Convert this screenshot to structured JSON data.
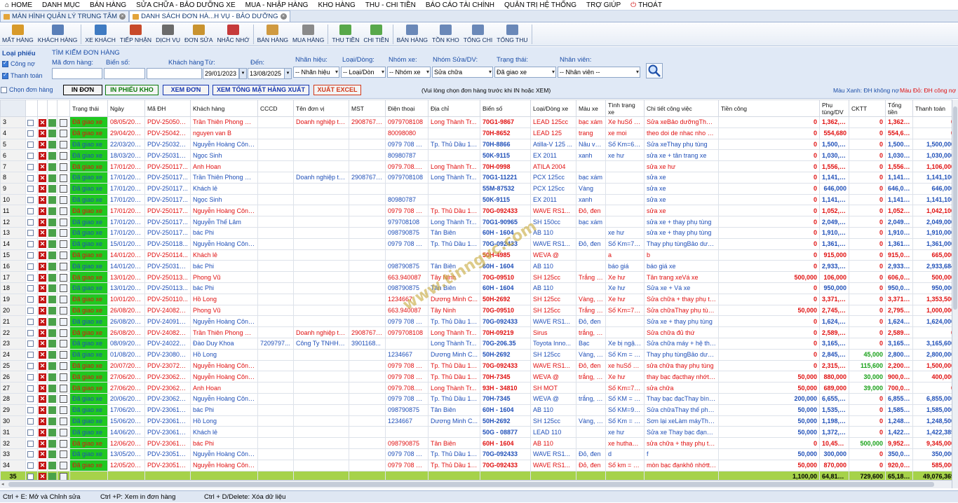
{
  "menu": [
    {
      "label": "HOME",
      "icon": "home-icon",
      "glyph": "⌂"
    },
    {
      "label": "DANH MỤC"
    },
    {
      "label": "BÁN HÀNG"
    },
    {
      "label": "SỬA CHỮA - BẢO DƯỠNG XE"
    },
    {
      "label": "MUA - NHẬP HÀNG"
    },
    {
      "label": "KHO HÀNG"
    },
    {
      "label": "THU - CHI TIỀN"
    },
    {
      "label": "BÁO CÁO TÀI CHÍNH"
    },
    {
      "label": "QUẢN TRỊ HỆ THỐNG"
    },
    {
      "label": "TRỢ GIÚP"
    },
    {
      "label": "THOÁT",
      "icon": "power-icon",
      "glyph": "⏻"
    }
  ],
  "tabs": [
    {
      "label": "MÀN HÌNH QUẢN LÝ TRUNG TÂM",
      "active": false
    },
    {
      "label": "DANH SÁCH ĐƠN HÀ...H VỤ - BẢO DƯỠNG",
      "active": true
    }
  ],
  "toolbar": [
    {
      "label": "MẤT HÀNG",
      "icon": "box-icon",
      "color": "#d89a2a"
    },
    {
      "label": "KHÁCH HÀNG",
      "icon": "customers-icon",
      "color": "#5a7fb8"
    },
    {
      "label": "XE KHÁCH",
      "icon": "vehicle-icon",
      "color": "#3f7bc2"
    },
    {
      "label": "TIẾP NHẬN",
      "icon": "receive-icon",
      "color": "#c84a2a"
    },
    {
      "label": "DỊCH VỤ",
      "icon": "tools-icon",
      "color": "#6b6b6b"
    },
    {
      "label": "ĐƠN SỬA",
      "icon": "repair-order-icon",
      "color": "#c9932f"
    },
    {
      "label": "NHẮC NHỚ",
      "icon": "calendar-icon",
      "color": "#c63a3a"
    },
    {
      "label": "BÁN HÀNG",
      "icon": "sell-icon",
      "color": "#d09a40"
    },
    {
      "label": "MUA HÀNG",
      "icon": "cart-icon",
      "color": "#8a8a8a"
    },
    {
      "label": "THU TIỀN",
      "icon": "money-in-icon",
      "color": "#58a84a"
    },
    {
      "label": "CHI TIỀN",
      "icon": "money-out-icon",
      "color": "#58a84a"
    },
    {
      "label": "BÁN HÀNG",
      "icon": "report-sales-icon",
      "color": "#6a88b8"
    },
    {
      "label": "TỒN KHO",
      "icon": "stock-icon",
      "color": "#6a88b8"
    },
    {
      "label": "TỔNG CHI",
      "icon": "report-expense-icon",
      "color": "#6a88b8"
    },
    {
      "label": "TỔNG THU",
      "icon": "report-income-icon",
      "color": "#6a88b8"
    }
  ],
  "filter": {
    "loai_phieu_label": "Loại phiếu",
    "cong_no_label": "Công nợ",
    "thanh_toan_label": "Thanh toán",
    "chon_don_hang_label": "Chọn đơn hàng",
    "search_title": "TÌM KIẾM ĐƠN HÀNG",
    "ma_don_hang_label": "Mã đơn hàng:",
    "bien_so_label": "Biển số:",
    "khach_hang_label": "Khách hàng",
    "tu_label": "Từ:",
    "den_label": "Đến:",
    "nhan_hieu_label": "Nhãn hiệu:",
    "loai_dong_label": "Loại/Dòng:",
    "nhom_xe_label": "Nhóm xe:",
    "nhom_sua_label": "Nhóm Sửa/DV:",
    "trang_thai_label": "Trạng thái:",
    "nhan_vien_label": "Nhân viên:",
    "tu_value": "29/01/2023",
    "den_value": "13/08/2025",
    "nhan_hieu_value": "-- Nhãn hiệu",
    "loai_dong_value": "-- Loại/Dòn",
    "nhom_xe_value": "-- Nhóm xe",
    "nhom_sua_value": "Sửa chữa",
    "trang_thai_value": "Đã giao xe",
    "nhan_vien_value": "-- Nhân viên --",
    "btn_in_don": "IN ĐƠN",
    "btn_in_phieu_kho": "IN PHIẾU KHO",
    "btn_xem_don": "XEM ĐƠN",
    "btn_xem_tong": "XEM TỔNG MẶT HÀNG XUẤT",
    "btn_xuat_excel": "XUẤT EXCEL",
    "hint": "(Vui lòng chọn đơn hàng trước khi IN hoặc XEM)",
    "legend_blue": "Màu Xanh: ĐH không nợ",
    "legend_red": "Màu Đỏ:  ĐH công nợ"
  },
  "columns": [
    "Trạng thái",
    "Ngày",
    "Mã ĐH",
    "Khách hàng",
    "CCCD",
    "Tên đơn vị",
    "MST",
    "Điện thoại",
    "Địa chỉ",
    "Biển số",
    "Loại/Dòng xe",
    "Màu xe",
    "Tình trạng xe",
    "Chi tiết công việc",
    "Tiền công",
    "Phụ tùng/DV",
    "CKTT",
    "Tổng tiền",
    "Thanh toán",
    "C"
  ],
  "rows": [
    {
      "n": "3",
      "c": "r",
      "v": [
        "Đã giao xe",
        "08/05/202...",
        "PDV-250508...",
        "Trần Thiên Phong Vân",
        "",
        "Doanh nghiệp tư...",
        "290876754",
        "0979708108",
        "Long Thành Tr...",
        "70G1-9867",
        "LEAD 125cc",
        "bạc xám",
        "Xe huSố km=895433",
        "Sửa xeBảo dưỡngThay phụ tùng",
        "0",
        "1,362,960",
        "0",
        "1,362,960",
        "0"
      ]
    },
    {
      "n": "4",
      "c": "r",
      "v": [
        "Đã giao xe",
        "29/04/202...",
        "PDV-250429...",
        "nguyen van B",
        "",
        "",
        "",
        "80098080",
        "",
        "70H-8652",
        "LEAD 125",
        "trang",
        "xe moi",
        "theo doi de nhac nho bao duong",
        "0",
        "554,680",
        "0",
        "554,680",
        "0"
      ]
    },
    {
      "n": "5",
      "c": "b",
      "v": [
        "Đã giao xe",
        "22/03/202...",
        "PDV-250326...",
        "Nguyễn Hoàng Công ...",
        "",
        "",
        "",
        "0979 708 108",
        "Tp. Thủ Dầu 1,...",
        "70H-8866",
        "Atilla-V 125 ...",
        "Nâu vàng",
        "Số Km=67450",
        "Sửa xeThay phụ tùng",
        "0",
        "1,500,000",
        "0",
        "1,500,000",
        "1,500,000"
      ]
    },
    {
      "n": "6",
      "c": "b",
      "v": [
        "Đã giao xe",
        "18/03/202...",
        "PDV-250318...",
        "Ngọc Sinh",
        "",
        "",
        "",
        "80980787",
        "",
        "50K-9115",
        "EX 2011",
        "xanh",
        "xe hư",
        "sửa xe + tân trang xe",
        "0",
        "1,030,000",
        "0",
        "1,030,000",
        "1,030,000"
      ]
    },
    {
      "n": "7",
      "c": "r",
      "v": [
        "Đã giao xe",
        "17/01/202...",
        "PDV-250117...",
        "Anh Hoan",
        "",
        "",
        "",
        "0979.708.987",
        "Long Thành Tr...",
        "70H-0998",
        "ATILA 2004",
        "",
        "",
        "sửa xe hư",
        "0",
        "1,556,000",
        "0",
        "1,556,000",
        "1,106,000"
      ]
    },
    {
      "n": "8",
      "c": "b",
      "v": [
        "Đã giao xe",
        "17/01/202...",
        "PDV-250117...",
        "Trần Thiên Phong Vân",
        "",
        "Doanh nghiệp tư...",
        "290876754",
        "0979708108",
        "Long Thành Tr...",
        "70G1-11221",
        "PCX 125cc",
        "bạc xám",
        "",
        "sửa xe",
        "0",
        "1,141,100",
        "0",
        "1,141,100",
        "1,141,100"
      ]
    },
    {
      "n": "9",
      "c": "b",
      "v": [
        "Đã giao xe",
        "17/01/202...",
        "PDV-250117...",
        "Khách lẻ",
        "",
        "",
        "",
        "",
        "",
        "55M-87532",
        "PCX 125cc",
        "Vàng",
        "",
        "sửa xe",
        "0",
        "646,000",
        "0",
        "646,000",
        "646,000"
      ]
    },
    {
      "n": "10",
      "c": "b",
      "v": [
        "Đã giao xe",
        "17/01/202...",
        "PDV-250117...",
        "Ngọc Sinh",
        "",
        "",
        "",
        "80980787",
        "",
        "50K-9115",
        "EX 2011",
        "xanh",
        "",
        "sửa xe",
        "0",
        "1,141,100",
        "0",
        "1,141,100",
        "1,141,100"
      ]
    },
    {
      "n": "11",
      "c": "r",
      "v": [
        "Đã giao xe",
        "17/01/202...",
        "PDV-250117...",
        "Nguyễn Hoàng Công ...",
        "",
        "",
        "",
        "0979 708 108",
        "Tp. Thủ Dầu 1,...",
        "70G-092433",
        "WAVE RS1...",
        "Đỏ, đen",
        "",
        "sửa xe",
        "0",
        "1,052,000",
        "0",
        "1,052,000",
        "1,042,100"
      ]
    },
    {
      "n": "12",
      "c": "b",
      "v": [
        "Đã giao xe",
        "17/01/202...",
        "PDV-250117...",
        "Nguyễn Thế Lâm",
        "",
        "",
        "",
        "979708108",
        "Long Thành Tr...",
        "70G1-90965",
        "SH 150cc",
        "bạc xám",
        "",
        "sửa xe + thay phụ tùng",
        "0",
        "2,049,000",
        "0",
        "2,049,000",
        "2,049,000"
      ]
    },
    {
      "n": "13",
      "c": "b",
      "v": [
        "Đã giao xe",
        "17/01/202...",
        "PDV-250117...",
        "bác Phi",
        "",
        "",
        "",
        "098790875",
        "Tân Biên",
        "60H - 1604",
        "AB 110",
        "",
        "xe hư",
        "sửa xe + thay phụ tùng",
        "0",
        "1,910,000",
        "0",
        "1,910,000",
        "1,910,000"
      ]
    },
    {
      "n": "14",
      "c": "b",
      "v": [
        "Đã giao xe",
        "15/01/202...",
        "PDV-250118...",
        "Nguyễn Hoàng Công ...",
        "",
        "",
        "",
        "0979 708 108",
        "Tp. Thủ Dầu 1,...",
        "70G-092433",
        "WAVE RS1...",
        "Đỏ, đen",
        "Số Km=78506",
        "Thay phụ tùngBảo dưỡng xeLàm ...",
        "0",
        "1,361,000",
        "0",
        "1,361,000",
        "1,361,000"
      ]
    },
    {
      "n": "15",
      "c": "r",
      "v": [
        "Đã giao xe",
        "14/01/202...",
        "PDV-250114...",
        "Khách lẻ",
        "",
        "",
        "",
        "",
        "",
        "50H-4985",
        "WEVA @",
        "",
        "a",
        "b",
        "0",
        "915,000",
        "0",
        "915,000",
        "665,000"
      ]
    },
    {
      "n": "16",
      "c": "b",
      "v": [
        "Đã giao xe",
        "14/01/202...",
        "PDV-250318...",
        "bác Phi",
        "",
        "",
        "",
        "098790875",
        "Tân Biên",
        "60H - 1604",
        "AB 110",
        "",
        "báo giá",
        "báo giá xe",
        "0",
        "2,933,684",
        "0",
        "2,933,684",
        "2,933,684"
      ]
    },
    {
      "n": "17",
      "c": "r",
      "v": [
        "Đã giao xe",
        "13/01/202...",
        "PDV-250113...",
        "Phong Vũ",
        "",
        "",
        "",
        "663.940087",
        "Tây Ninh",
        "70G-09510",
        "SH 125cc",
        "Trắng đ...",
        "Xe hư",
        "Tân trang xeVá xe",
        "500,000",
        "106,000",
        "0",
        "606,000",
        "500,000"
      ]
    },
    {
      "n": "18",
      "c": "b",
      "v": [
        "Đã giao xe",
        "13/01/202...",
        "PDV-250113...",
        "bác Phi",
        "",
        "",
        "",
        "098790875",
        "Tân Biên",
        "60H - 1604",
        "AB 110",
        "",
        "Xe hư",
        "Sửa xe + Vá xe",
        "0",
        "950,000",
        "0",
        "950,000",
        "950,000"
      ]
    },
    {
      "n": "19",
      "c": "r",
      "v": [
        "Đã giao xe",
        "10/01/202...",
        "PDV-250110...",
        "Hồ Long",
        "",
        "",
        "",
        "1234667",
        "Dương Minh C...",
        "50H-2692",
        "SH 125cc",
        "Vàng, T...",
        "Xe hư",
        "Sửa chữa + thay phụ tùng",
        "0",
        "3,371,500",
        "0",
        "3,371,500",
        "1,353,500"
      ]
    },
    {
      "n": "20",
      "c": "r",
      "v": [
        "Đã giao xe",
        "26/08/202...",
        "PDV-240826...",
        "Phong Vũ",
        "",
        "",
        "",
        "663.940087",
        "Tây Ninh",
        "70G-09510",
        "SH 125cc",
        "Trắng đ...",
        "Số Km=78968Xe hư nhi...",
        "Sửa chữaThay phụ tùng xeTân tra...",
        "50,000",
        "2,745,790",
        "0",
        "2,795,790",
        "1,000,000"
      ]
    },
    {
      "n": "21",
      "c": "b",
      "v": [
        "Đã giao xe",
        "26/08/202...",
        "PDV-240915...",
        "Nguyễn Hoàng Công ...",
        "",
        "",
        "",
        "0979 708 108",
        "Tp. Thủ Dầu 1,...",
        "70G-092433",
        "WAVE RS1...",
        "Đỏ, đen",
        "",
        "Sửa xe + thay phụ tùng",
        "0",
        "1,624,000",
        "0",
        "1,624,000",
        "1,624,000"
      ]
    },
    {
      "n": "22",
      "c": "r",
      "v": [
        "Đã giao xe",
        "26/08/202...",
        "PDV-240826...",
        "Trần Thiên Phong Vân",
        "",
        "Doanh nghiệp tư...",
        "290876754",
        "0979708108",
        "Long Thành Tr...",
        "70H-09219",
        "Sirus",
        "trắng, b...",
        "",
        "Sửa chữa đủ thứ",
        "0",
        "2,589,160",
        "0",
        "2,589,160",
        "0"
      ]
    },
    {
      "n": "23",
      "c": "b",
      "v": [
        "Đã giao xe",
        "08/09/202...",
        "PDV-240222...",
        "Đào Duy Khoa",
        "7209797...",
        "Công Ty TNHH T...",
        "3901168...",
        "",
        "Long Thành Tr...",
        "70G-206.35",
        "Toyota Inno...",
        "Bạc",
        "Xe bị ngập nước chết m...",
        "Sửa chữa máy + hệ thống điệnTh...",
        "0",
        "3,165,600",
        "0",
        "3,165,600",
        "3,165,600"
      ]
    },
    {
      "n": "24",
      "c": "b",
      "v": [
        "Đã giao xe",
        "01/08/202...",
        "PDV-230801...",
        "Hồ Long",
        "",
        "",
        "",
        "1234667",
        "Dương Minh C...",
        "50H-2692",
        "SH 125cc",
        "Vàng, T...",
        "Số Km = 134509Xe ngậ...",
        "Thay phụ tùngBảo dưỡng xeSơn xe",
        "0",
        "2,845,000",
        "45,000",
        "2,800,000",
        "2,800,000"
      ]
    },
    {
      "n": "25",
      "c": "r",
      "v": [
        "Đã giao xe",
        "20/07/202...",
        "PDV-230720...",
        "Nguyễn Hoàng Công ...",
        "",
        "",
        "",
        "0979 708 108",
        "Tp. Thủ Dầu 1,...",
        "70G-092433",
        "WAVE RS1...",
        "Đỏ, đen",
        "xe huSố Km=43208",
        "sửa chữa thay phụ tùng",
        "0",
        "2,315,600",
        "115,600",
        "2,200,000",
        "1,500,000"
      ]
    },
    {
      "n": "26",
      "c": "r",
      "v": [
        "Đã giao xe",
        "27/06/202...",
        "PDV-230627...",
        "Nguyễn Hoàng Công ...",
        "",
        "",
        "",
        "0979 708 108",
        "Tp. Thủ Dầu 1,...",
        "70H-7345",
        "WEVA @",
        "trắng, v...",
        "Xe hư",
        "thay bạc đạcthay nhớtrửa xe",
        "50,000",
        "880,000",
        "30,000",
        "900,000",
        "400,000"
      ]
    },
    {
      "n": "27",
      "c": "r",
      "v": [
        "Đã giao xe",
        "27/06/202...",
        "PDV-230627...",
        "Anh Hoan",
        "",
        "",
        "",
        "0979.708.987",
        "Long Thành Tr...",
        "93H - 34810",
        "SH MOT",
        "",
        "Số Km=78450",
        "sửa chữa",
        "50,000",
        "689,000",
        "39,000",
        "700,000",
        "0"
      ]
    },
    {
      "n": "28",
      "c": "b",
      "v": [
        "Đã giao xe",
        "20/06/202...",
        "PDV-230620...",
        "Nguyễn Hoàng Công ...",
        "",
        "",
        "",
        "0979 708 108",
        "Tp. Thủ Dầu 1,...",
        "70H-7345",
        "WEVA @",
        "trắng, v...",
        "Số KM = 990465Xe lâu ...",
        "Thay bạc đạcThay bình điện + đề ...",
        "200,000",
        "6,655,000",
        "0",
        "6,855,000",
        "6,855,000"
      ]
    },
    {
      "n": "29",
      "c": "b",
      "v": [
        "Đã giao xe",
        "17/06/202...",
        "PDV-230617...",
        "bác Phi",
        "",
        "",
        "",
        "098790875",
        "Tân Biên",
        "60H - 1604",
        "AB 110",
        "",
        "Số KM=907876Xe lâu n...",
        "Sửa chữaThay thế phụ tùng linh k...",
        "50,000",
        "1,535,000",
        "0",
        "1,585,000",
        "1,585,000"
      ]
    },
    {
      "n": "30",
      "c": "b",
      "v": [
        "Đã giao xe",
        "15/06/202...",
        "PDV-230615...",
        "Hồ Long",
        "",
        "",
        "",
        "1234667",
        "Dương Minh C...",
        "50H-2692",
        "SH 125cc",
        "Vàng, T...",
        "Số Km = 54330Xe xuốn...",
        "Sơn lại xeLàm máyThay nhớt",
        "50,000",
        "1,198,500",
        "0",
        "1,248,500",
        "1,248,500"
      ]
    },
    {
      "n": "31",
      "c": "b",
      "v": [
        "Đã giao xe",
        "14/06/202...",
        "PDV-230614...",
        "Khách lẻ",
        "",
        "",
        "",
        "",
        "",
        "50G - 08877",
        "LEAD 110",
        "",
        "xe hư",
        "Sửa xe Thay bạc đạnĐầu nhớ",
        "50,000",
        "1,372,385",
        "0",
        "1,422,385",
        "1,422,385"
      ]
    },
    {
      "n": "32",
      "c": "r",
      "v": [
        "Đã giao xe",
        "12/06/202...",
        "PDV-230612...",
        "bác Phi",
        "",
        "",
        "",
        "098790875",
        "Tân Biên",
        "60H - 1604",
        "AB 110",
        "",
        "xe huthay sửaphục hồi",
        "sửa chữa + thay phụ tùngrửa xen...",
        "0",
        "10,452,500",
        "500,000",
        "9,952,500",
        "9,345,000"
      ]
    },
    {
      "n": "33",
      "c": "b",
      "v": [
        "Đã giao xe",
        "13/05/202...",
        "PDV-230513...",
        "Nguyễn Hoàng Công ...",
        "",
        "",
        "",
        "0979 708 108",
        "Tp. Thủ Dầu 1,...",
        "70G-092433",
        "WAVE RS1...",
        "Đỏ, đen",
        "d",
        "f",
        "50,000",
        "300,000",
        "0",
        "350,000",
        "350,000"
      ]
    },
    {
      "n": "34",
      "c": "r",
      "v": [
        "Đã giao xe",
        "12/05/202...",
        "PDV-230512...",
        "Nguyễn Hoàng Công ...",
        "",
        "",
        "",
        "0979 708 108",
        "Tp. Thủ Dầu 1,...",
        "70G-092433",
        "WAVE RS1...",
        "Đỏ, đen",
        "Số km = 45045",
        "mòn bạc đạnkhô nhớtthay bạc đạn",
        "50,000",
        "870,000",
        "0",
        "920,000",
        "585,000"
      ]
    }
  ],
  "totals": {
    "n": "35",
    "tien_cong": "1,100,00",
    "phu_tung": "64,810,559",
    "cktt": "729,600",
    "tong_tien": "65,180,959",
    "thanh_toan": "49,076,369"
  },
  "watermark": "www.tinngvc.com",
  "status": {
    "hint1": "Ctrl + E:  Mở và Chỉnh sửa",
    "hint2": "Ctrl +P:  Xem in đơn hàng",
    "hint3": "Ctrl + D/Delete:  Xóa dữ liệu"
  }
}
